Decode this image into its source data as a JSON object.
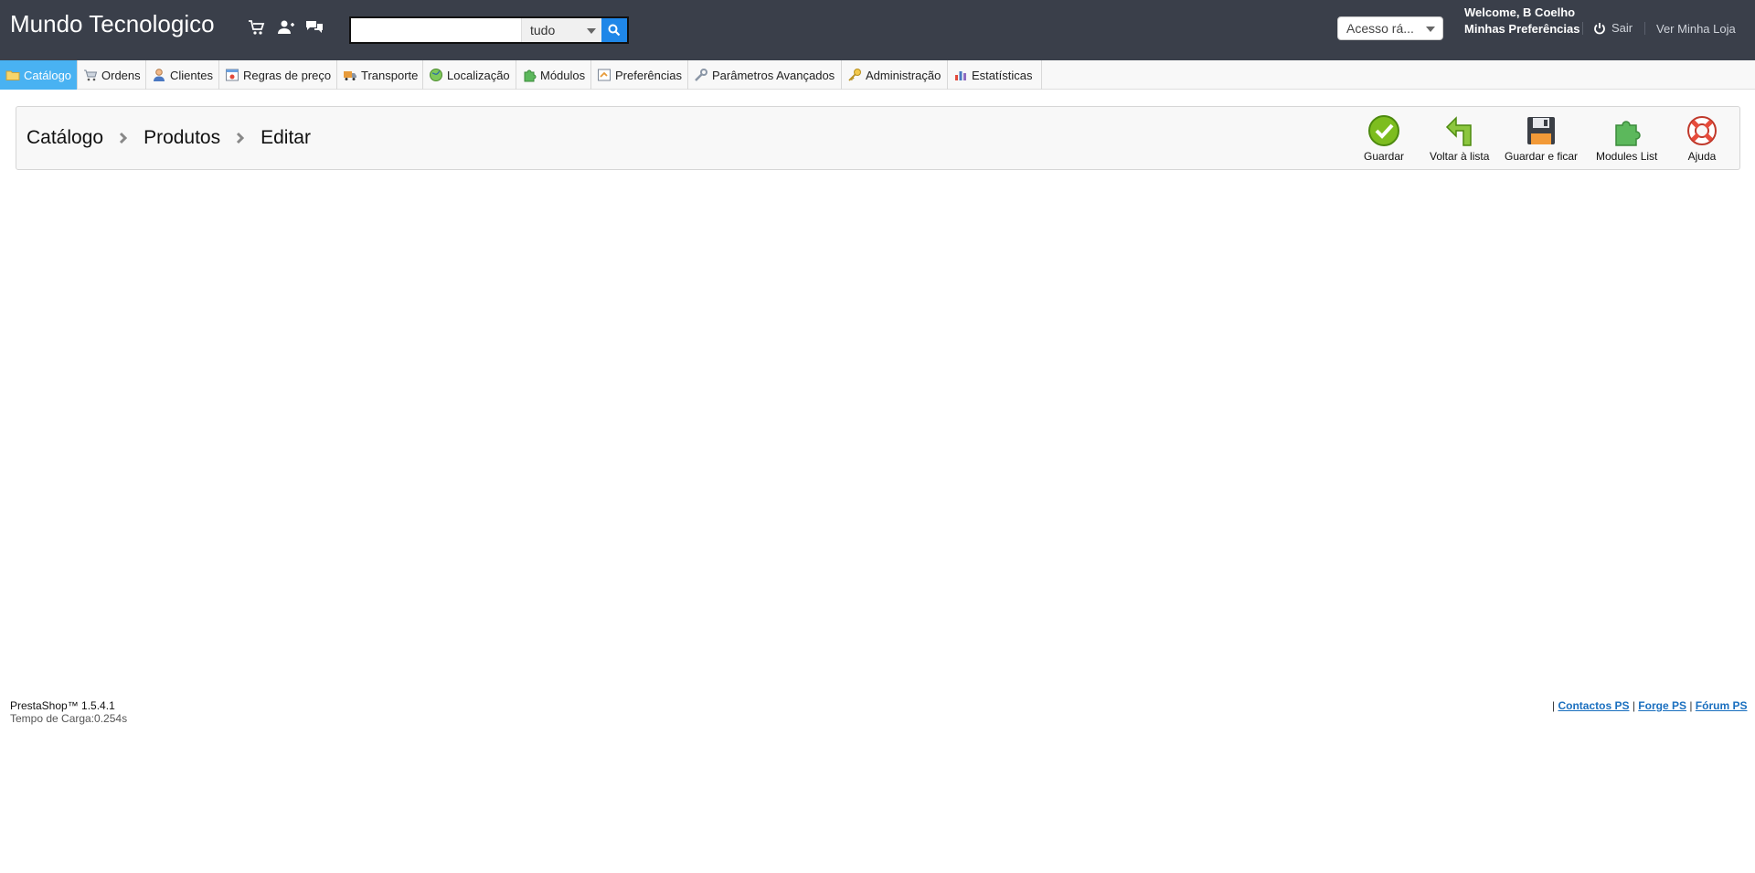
{
  "header": {
    "shop_name": "Mundo Tecnologico",
    "search": {
      "value": "",
      "placeholder": "",
      "scope": "tudo"
    },
    "quick_access": "Acesso rá...",
    "welcome": "Welcome, B Coelho",
    "preferences": "Minhas Preferências",
    "logout": "Sair",
    "view_shop": "Ver Minha Loja"
  },
  "tabs": [
    {
      "label": "Catálogo",
      "icon": "folder-icon",
      "active": true
    },
    {
      "label": "Ordens",
      "icon": "cart-icon"
    },
    {
      "label": "Clientes",
      "icon": "user-icon"
    },
    {
      "label": "Regras de preço",
      "icon": "price-rule-icon"
    },
    {
      "label": "Transporte",
      "icon": "truck-icon"
    },
    {
      "label": "Localização",
      "icon": "globe-icon"
    },
    {
      "label": "Módulos",
      "icon": "puzzle-icon"
    },
    {
      "label": "Preferências",
      "icon": "preferences-icon"
    },
    {
      "label": "Parâmetros Avançados",
      "icon": "wrench-icon"
    },
    {
      "label": "Administração",
      "icon": "key-icon"
    },
    {
      "label": "Estatísticas",
      "icon": "stats-icon"
    }
  ],
  "breadcrumb": [
    "Catálogo",
    "Produtos",
    "Editar"
  ],
  "toolbar": {
    "save": "Guardar",
    "back": "Voltar à lista",
    "save_stay": "Guardar e ficar",
    "modules": "Modules List",
    "help": "Ajuda"
  },
  "footer": {
    "version": "PrestaShop™ 1.5.4.1",
    "load_time": "Tempo de Carga:0.254s",
    "pipe": "|",
    "links": [
      "Contactos PS",
      "Forge PS",
      "Fórum PS"
    ]
  },
  "colors": {
    "header_bg": "#3a3f4a",
    "active_tab": "#49b2f2",
    "search_button": "#1f87e8",
    "link": "#1a6fbf"
  }
}
